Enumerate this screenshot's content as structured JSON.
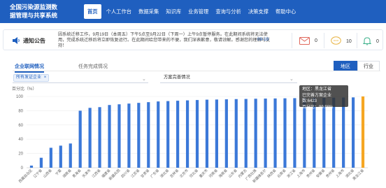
{
  "brand": {
    "line1": "全国污染源监测数",
    "line2": "据管理与共享系统"
  },
  "nav": [
    "首页",
    "个人工作台",
    "数据采集",
    "知识库",
    "业务管理",
    "查询与分析",
    "决策支撑",
    "帮助中心"
  ],
  "notice": {
    "title": "通知公告",
    "text": "因系统迁移工作，9月19日（本周五）下午5点至9月22日（下周一）上午9点暂停服务。在此期间系统将无法使用，完成系统迁移后将立即恢复运行。在此期间给您带来的不便，我们深表歉意，敬请谅解。感谢您的理解与支持！",
    "dates": "09-19",
    "mail_count": "0",
    "chat_count": "10",
    "bell_count": "0"
  },
  "panel": {
    "tab_active": "企业联网情况",
    "tab_inactive": "任务完成情况",
    "seg_on": "地区",
    "seg_off": "行业",
    "filter_chip": "所有发证企业",
    "filter_close": "×",
    "filter_right": "方案完善情况"
  },
  "chart_data": {
    "type": "bar",
    "ylabel": "百分比（%）",
    "ylim": [
      0,
      100
    ],
    "yticks": [
      0,
      20,
      40,
      60,
      80,
      100
    ],
    "categories": [
      "西藏自治区",
      "辽宁省",
      "山西省",
      "宁夏回族自治区",
      "湖南省",
      "青海省",
      "天津市",
      "江西省",
      "福建省",
      "新疆兵团",
      "四川省",
      "江苏省",
      "甘肃省",
      "广东省",
      "湖北省",
      "吉林省",
      "北京市",
      "河北省",
      "重庆市",
      "河南省",
      "海南省",
      "山东省",
      "内蒙古自治区",
      "广西壮族自治区",
      "新疆维吾尔自治区",
      "陕西省",
      "云南省",
      "浙江省",
      "上海市",
      "贵州省",
      "安徽省",
      "贵州",
      "上海",
      "湖北",
      "黑龙江省"
    ],
    "x_labels_visible": [
      "西藏自治区",
      "辽宁省",
      "山西省",
      "宁夏",
      "湖南省",
      "青海省",
      "天津市",
      "江西省",
      "福建省",
      "新疆兵团",
      "四川省",
      "江苏省",
      "甘肃省",
      "广东省",
      "湖北省",
      "吉林省",
      "北京市",
      "河北省",
      "重庆市",
      "河南省",
      "海南省",
      "山东省",
      "内蒙古",
      "广西壮族",
      "新疆维吾尔",
      "陕西省",
      "云南省",
      "浙江省",
      "上海市",
      "贵州省",
      "安徽省",
      "贵州省",
      "上海市",
      "湖北省",
      "黑龙江省"
    ],
    "values": [
      3,
      14,
      28,
      31,
      34,
      80,
      84,
      85,
      88,
      89,
      90,
      91,
      92,
      93,
      93.5,
      94,
      94.5,
      95,
      95.5,
      95.7,
      96,
      96.3,
      96.5,
      96.8,
      97,
      97.2,
      97.4,
      97.6,
      97.8,
      98,
      98.1,
      98.3,
      98.5,
      98.7,
      99.98
    ],
    "highlight_index": 34,
    "bar_color": "#3b78d8",
    "highlight_color": "#f5a623",
    "grid": true
  },
  "tooltip": {
    "line1": "地区：黑龙江省",
    "line2": "已完善方案企业数:6423",
    "line3": "百分比：99.98%"
  }
}
